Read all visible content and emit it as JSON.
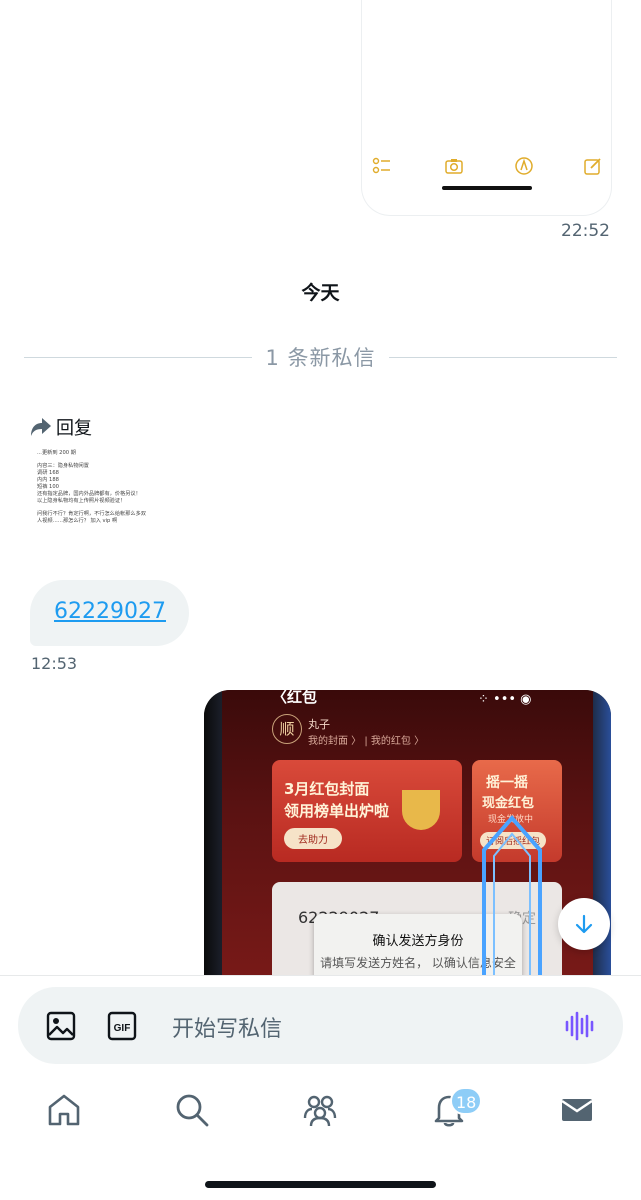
{
  "conversation": {
    "first_timestamp": "22:52",
    "day_header": "今天",
    "new_messages_divider": "1 条新私信",
    "reply_label": "回复",
    "reply_preview_lines": [
      "...更新到 200 期",
      "",
      "内容三：隐身私物闲置",
      "调研 168",
      "内内 188",
      "短裤 100",
      "还有指定品牌，国内外品牌都有，价格另议！",
      "以上隐身私物均有上传照片视频验证！",
      "",
      "问我行不行？肯定行啊，不行怎么给帐那么多双",
      "人视频……那怎么行？ 加入 vip 啊"
    ],
    "link_message": "62229027",
    "second_timestamp": "12:53",
    "screenshot": {
      "nav_title": "红包",
      "user_name": "丸子",
      "user_links": "我的封面 〉 | 我的红包 〉",
      "banner_left_line1": "3月红包封面",
      "banner_left_line2": "领用榜单出炉啦",
      "banner_left_button": "去助力",
      "banner_right_line1": "摇一摇",
      "banner_right_line2": "现金红包",
      "banner_right_sub": "现金发放中",
      "banner_right_button": "订阅后摇红包",
      "account_number": "62229027",
      "account_action": "确定",
      "dialog_title": "确认发送方身份",
      "dialog_text": "请填写发送方姓名， 以确认信息安全"
    }
  },
  "composer": {
    "placeholder": "开始写私信"
  },
  "tabbar": {
    "notifications_badge": "18"
  },
  "icons": [
    "checklist-icon",
    "camera-icon",
    "markup-icon",
    "compose-icon",
    "reply-arrow-icon",
    "arrow-down-icon",
    "image-icon",
    "gif-icon",
    "voice-icon",
    "home-icon",
    "search-icon",
    "communities-icon",
    "bell-icon",
    "mail-icon"
  ],
  "colors": {
    "link": "#1d9bf0",
    "accent_voice": "#7856ff",
    "bubble": "#eff3f4",
    "notes_yellow": "#e0ac2b"
  }
}
